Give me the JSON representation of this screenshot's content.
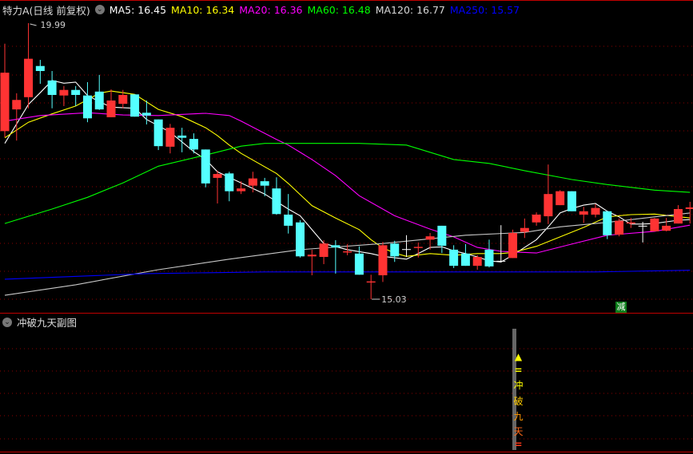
{
  "header": {
    "title": "特力A(日线 前复权)",
    "ma_labels": [
      {
        "text": "MA5: 16.45",
        "color": "#ffffff"
      },
      {
        "text": "MA10: 16.34",
        "color": "#ffff00"
      },
      {
        "text": "MA20: 16.36",
        "color": "#ff00ff"
      },
      {
        "text": "MA60: 16.48",
        "color": "#00ff00"
      },
      {
        "text": "MA120: 16.77",
        "color": "#d8d8d8"
      },
      {
        "text": "MA250: 15.57",
        "color": "#0000ff"
      }
    ]
  },
  "sub_panel": {
    "title": "冲破九天副图",
    "signal_chars": [
      "冲",
      "破",
      "九",
      "天"
    ],
    "signal_colors": [
      "#ffff00",
      "#ffcc00",
      "#ff9900",
      "#ff6a1a"
    ]
  },
  "markers": {
    "high_label": "19.99",
    "low_label": "15.03",
    "jian_label": "减"
  },
  "colors": {
    "up": "#ff3333",
    "down": "#54ffff",
    "flat": "#ffffff",
    "grid": "#8b0000",
    "border": "#c00000"
  },
  "chart_data": {
    "type": "candlestick",
    "title": "特力A(日线 前复权)",
    "ylim": [
      15.03,
      19.99
    ],
    "ohlc": [
      [
        18.05,
        19.62,
        17.94,
        19.1
      ],
      [
        18.44,
        18.73,
        17.88,
        18.61
      ],
      [
        18.66,
        19.99,
        18.46,
        19.35
      ],
      [
        19.22,
        19.33,
        18.9,
        19.13
      ],
      [
        18.96,
        19.13,
        18.46,
        18.7
      ],
      [
        18.69,
        18.86,
        18.5,
        18.79
      ],
      [
        18.79,
        18.86,
        18.5,
        18.7
      ],
      [
        18.69,
        18.93,
        18.21,
        18.28
      ],
      [
        18.76,
        19.06,
        18.43,
        18.44
      ],
      [
        18.3,
        18.8,
        18.3,
        18.6
      ],
      [
        18.54,
        18.79,
        18.46,
        18.7
      ],
      [
        18.71,
        18.71,
        18.31,
        18.31
      ],
      [
        18.38,
        18.6,
        18.17,
        18.33
      ],
      [
        18.26,
        18.26,
        17.71,
        17.78
      ],
      [
        17.77,
        18.18,
        17.65,
        18.11
      ],
      [
        17.97,
        18.11,
        17.67,
        17.93
      ],
      [
        17.91,
        18.01,
        17.65,
        17.72
      ],
      [
        17.72,
        17.72,
        17.04,
        17.11
      ],
      [
        17.21,
        17.34,
        16.75,
        17.28
      ],
      [
        17.29,
        17.32,
        16.79,
        16.97
      ],
      [
        16.97,
        17.15,
        16.92,
        17.02
      ],
      [
        17.07,
        17.32,
        16.95,
        17.2
      ],
      [
        17.15,
        17.21,
        16.88,
        17.07
      ],
      [
        17.02,
        17.22,
        16.55,
        16.56
      ],
      [
        16.55,
        16.92,
        16.21,
        16.35
      ],
      [
        16.41,
        16.45,
        15.78,
        15.8
      ],
      [
        15.8,
        15.92,
        15.46,
        15.83
      ],
      [
        15.79,
        16.09,
        15.66,
        16.03
      ],
      [
        16.0,
        16.09,
        15.49,
        15.96
      ],
      [
        15.87,
        16.02,
        15.82,
        15.89
      ],
      [
        15.85,
        15.98,
        15.47,
        15.47
      ],
      [
        15.33,
        15.47,
        15.03,
        15.35
      ],
      [
        15.46,
        16.06,
        15.34,
        16.0
      ],
      [
        16.03,
        16.08,
        15.7,
        15.8
      ],
      [
        15.93,
        16.18,
        15.79,
        15.93
      ],
      [
        15.95,
        16.05,
        15.78,
        15.97
      ],
      [
        16.1,
        16.22,
        15.92,
        16.16
      ],
      [
        16.35,
        16.35,
        15.86,
        15.99
      ],
      [
        15.92,
        16.0,
        15.59,
        15.63
      ],
      [
        15.85,
        16.02,
        15.63,
        15.63
      ],
      [
        15.63,
        15.82,
        15.56,
        15.79
      ],
      [
        15.92,
        16.1,
        15.6,
        15.62
      ],
      [
        15.72,
        16.36,
        15.69,
        15.72
      ],
      [
        15.77,
        16.28,
        15.77,
        16.22
      ],
      [
        16.24,
        16.48,
        16.13,
        16.31
      ],
      [
        16.41,
        16.59,
        16.35,
        16.55
      ],
      [
        16.52,
        17.45,
        16.38,
        16.92
      ],
      [
        16.72,
        16.99,
        16.72,
        16.97
      ],
      [
        16.97,
        16.97,
        16.61,
        16.61
      ],
      [
        16.55,
        16.69,
        16.4,
        16.61
      ],
      [
        16.55,
        16.74,
        16.5,
        16.67
      ],
      [
        16.61,
        16.61,
        16.11,
        16.18
      ],
      [
        16.19,
        16.48,
        16.16,
        16.44
      ],
      [
        16.39,
        16.49,
        16.31,
        16.41
      ],
      [
        16.35,
        16.42,
        16.05,
        16.35
      ],
      [
        16.25,
        16.49,
        16.25,
        16.48
      ],
      [
        16.26,
        16.49,
        16.25,
        16.35
      ],
      [
        16.39,
        16.72,
        16.39,
        16.65
      ],
      [
        16.65,
        16.78,
        16.39,
        16.68
      ]
    ],
    "high_point": {
      "index": 2,
      "value": 19.99
    },
    "low_point": {
      "index": 31,
      "value": 15.03
    },
    "series": [
      {
        "name": "MA5",
        "color": "#ffffff",
        "points": [
          [
            0,
            17.83
          ],
          [
            1,
            18.18
          ],
          [
            2,
            18.53
          ],
          [
            3,
            18.74
          ],
          [
            4,
            18.96
          ],
          [
            5,
            18.91
          ],
          [
            6,
            18.93
          ],
          [
            7,
            18.69
          ],
          [
            8,
            18.58
          ],
          [
            9,
            18.48
          ],
          [
            11,
            18.46
          ],
          [
            12,
            18.26
          ],
          [
            14,
            18.03
          ],
          [
            16,
            17.68
          ],
          [
            17,
            17.54
          ],
          [
            18,
            17.32
          ],
          [
            19,
            17.22
          ],
          [
            21,
            17.02
          ],
          [
            22,
            16.92
          ],
          [
            24,
            16.65
          ],
          [
            25,
            16.53
          ],
          [
            27,
            16.03
          ],
          [
            29,
            15.92
          ],
          [
            31,
            15.85
          ],
          [
            32,
            15.8
          ],
          [
            34,
            15.75
          ],
          [
            35,
            15.85
          ],
          [
            36,
            15.96
          ],
          [
            37,
            15.97
          ],
          [
            38,
            15.9
          ],
          [
            39,
            15.85
          ],
          [
            40,
            15.79
          ],
          [
            41,
            15.72
          ],
          [
            42,
            15.7
          ],
          [
            43,
            15.82
          ],
          [
            44,
            15.96
          ],
          [
            45,
            16.1
          ],
          [
            46,
            16.33
          ],
          [
            47,
            16.58
          ],
          [
            48,
            16.66
          ],
          [
            49,
            16.72
          ],
          [
            50,
            16.75
          ],
          [
            51,
            16.61
          ],
          [
            52,
            16.51
          ],
          [
            53,
            16.38
          ],
          [
            54,
            16.38
          ],
          [
            55,
            16.39
          ],
          [
            56,
            16.42
          ],
          [
            57,
            16.45
          ],
          [
            58,
            16.46
          ]
        ]
      },
      {
        "name": "MA10",
        "color": "#ffff00",
        "points": [
          [
            0,
            17.93
          ],
          [
            2,
            18.21
          ],
          [
            4,
            18.36
          ],
          [
            6,
            18.5
          ],
          [
            8,
            18.73
          ],
          [
            9,
            18.77
          ],
          [
            11,
            18.71
          ],
          [
            13,
            18.44
          ],
          [
            15,
            18.31
          ],
          [
            17,
            18.11
          ],
          [
            18,
            17.97
          ],
          [
            19,
            17.8
          ],
          [
            20,
            17.65
          ],
          [
            23,
            17.29
          ],
          [
            24,
            17.11
          ],
          [
            26,
            16.71
          ],
          [
            28,
            16.49
          ],
          [
            30,
            16.28
          ],
          [
            31,
            16.1
          ],
          [
            32,
            15.95
          ],
          [
            33,
            15.86
          ],
          [
            34,
            15.8
          ],
          [
            36,
            15.85
          ],
          [
            38,
            15.82
          ],
          [
            40,
            15.85
          ],
          [
            42,
            15.85
          ],
          [
            43,
            15.87
          ],
          [
            45,
            15.98
          ],
          [
            47,
            16.15
          ],
          [
            49,
            16.32
          ],
          [
            51,
            16.51
          ],
          [
            53,
            16.55
          ],
          [
            55,
            16.56
          ],
          [
            58,
            16.49
          ]
        ]
      },
      {
        "name": "MA20",
        "color": "#ff00ff",
        "points": [
          [
            0,
            18.23
          ],
          [
            3,
            18.33
          ],
          [
            7,
            18.38
          ],
          [
            10,
            18.34
          ],
          [
            13,
            18.33
          ],
          [
            17,
            18.37
          ],
          [
            19,
            18.33
          ],
          [
            20,
            18.23
          ],
          [
            23,
            17.9
          ],
          [
            24,
            17.8
          ],
          [
            26,
            17.54
          ],
          [
            28,
            17.25
          ],
          [
            30,
            16.89
          ],
          [
            33,
            16.53
          ],
          [
            36,
            16.29
          ],
          [
            38,
            16.15
          ],
          [
            40,
            15.96
          ],
          [
            42,
            15.89
          ],
          [
            45,
            15.86
          ],
          [
            48,
            16.02
          ],
          [
            51,
            16.18
          ],
          [
            55,
            16.25
          ],
          [
            58,
            16.36
          ]
        ]
      },
      {
        "name": "MA60",
        "color": "#00ff00",
        "points": [
          [
            0,
            16.39
          ],
          [
            4,
            16.65
          ],
          [
            7,
            16.86
          ],
          [
            10,
            17.12
          ],
          [
            13,
            17.42
          ],
          [
            17,
            17.62
          ],
          [
            20,
            17.78
          ],
          [
            22,
            17.83
          ],
          [
            30,
            17.83
          ],
          [
            34,
            17.8
          ],
          [
            38,
            17.54
          ],
          [
            41,
            17.47
          ],
          [
            44,
            17.34
          ],
          [
            48,
            17.18
          ],
          [
            51,
            17.09
          ],
          [
            55,
            16.99
          ],
          [
            58,
            16.95
          ]
        ]
      },
      {
        "name": "MA120",
        "color": "#c8c8c8",
        "points": [
          [
            0,
            15.1
          ],
          [
            6,
            15.29
          ],
          [
            13,
            15.56
          ],
          [
            19,
            15.75
          ],
          [
            25,
            15.92
          ],
          [
            32,
            16.03
          ],
          [
            39,
            16.18
          ],
          [
            44,
            16.23
          ],
          [
            47,
            16.33
          ],
          [
            51,
            16.41
          ],
          [
            55,
            16.51
          ],
          [
            58,
            16.58
          ]
        ]
      },
      {
        "name": "MA250",
        "color": "#0000ff",
        "points": [
          [
            0,
            15.39
          ],
          [
            12,
            15.49
          ],
          [
            22,
            15.52
          ],
          [
            50,
            15.52
          ],
          [
            58,
            15.55
          ]
        ]
      }
    ],
    "sub_signal_index": 43
  }
}
